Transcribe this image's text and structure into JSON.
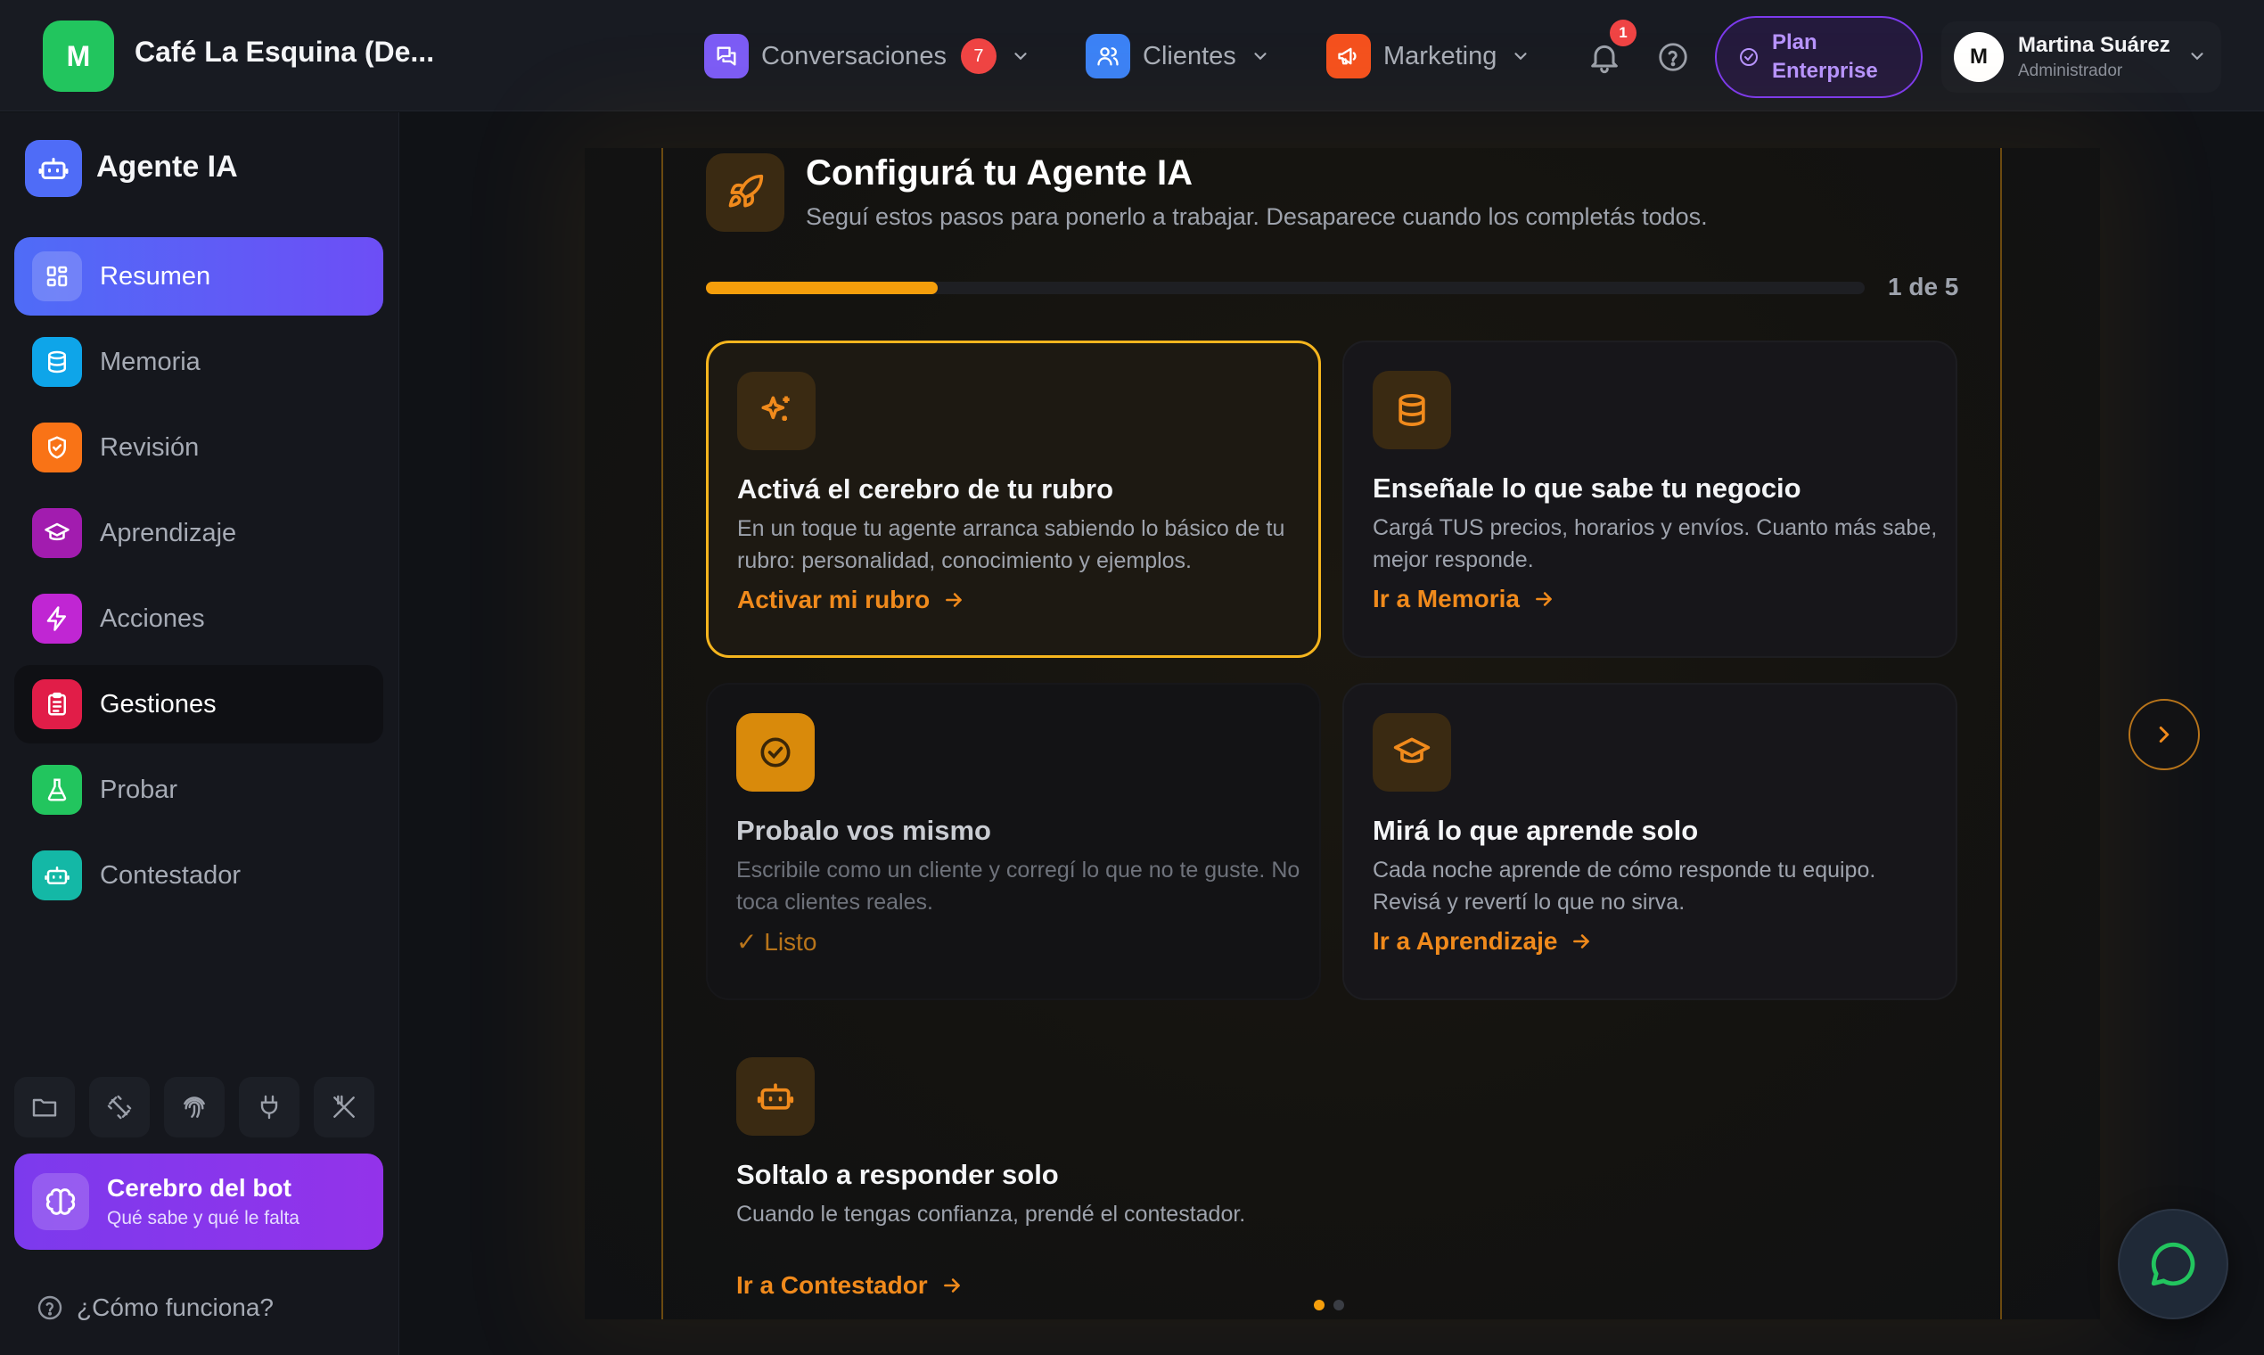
{
  "app": {
    "logo_letter": "M",
    "name": "Café La Esquina (De...",
    "brand_color": "#22c55e"
  },
  "topnav": {
    "items": [
      {
        "label": "Conversaciones",
        "badge": "7",
        "icon": "chat-bubbles-icon",
        "color": "#8b5cf6"
      },
      {
        "label": "Clientes",
        "icon": "users-icon",
        "color": "#3b82f6"
      },
      {
        "label": "Marketing",
        "icon": "megaphone-icon",
        "color": "#f97316"
      }
    ],
    "notifications_badge": "1",
    "plan": {
      "line1": "Plan",
      "line2": "Enterprise"
    },
    "user": {
      "initial": "M",
      "name": "Martina Suárez",
      "role": "Administrador"
    }
  },
  "sidebar": {
    "title": "Agente IA",
    "items": [
      {
        "label": "Resumen",
        "icon": "grid-icon",
        "color": "#6d7cf7",
        "state": "active"
      },
      {
        "label": "Memoria",
        "icon": "database-icon",
        "color": "#0ea5e9"
      },
      {
        "label": "Revisión",
        "icon": "shield-icon",
        "color": "#f97316"
      },
      {
        "label": "Aprendizaje",
        "icon": "graduation-cap-icon",
        "color": "#a21caf"
      },
      {
        "label": "Acciones",
        "icon": "bolt-icon",
        "color": "#c026d3"
      },
      {
        "label": "Gestiones",
        "icon": "clipboard-icon",
        "color": "#e11d48",
        "state": "hover"
      },
      {
        "label": "Probar",
        "icon": "flask-icon",
        "color": "#22c55e"
      },
      {
        "label": "Contestador",
        "icon": "robot-icon",
        "color": "#14b8a6"
      }
    ],
    "tools": [
      "folder-icon",
      "dumbbell-icon",
      "fingerprint-icon",
      "plug-icon",
      "utensils-icon"
    ],
    "brain_card": {
      "title": "Cerebro del bot",
      "subtitle": "Qué sabe y qué le falta"
    },
    "how_link": "¿Cómo funciona?"
  },
  "setup": {
    "title": "Configurá tu Agente IA",
    "subtitle": "Seguí estos pasos para ponerlo a trabajar. Desaparece cuando los completás todos.",
    "progress_fraction": 0.2,
    "progress_label": "1 de 5",
    "steps": [
      {
        "title": "Activá el cerebro de tu rubro",
        "desc": "En un toque tu agente arranca sabiendo lo básico de tu rubro: personalidad, conocimiento y ejemplos.",
        "link": "Activar mi rubro",
        "icon": "sparkles-icon"
      },
      {
        "title": "Enseñale lo que sabe tu negocio",
        "desc": "Cargá TUS precios, horarios y envíos. Cuanto más sabe, mejor responde.",
        "link": "Ir a Memoria",
        "icon": "database-icon"
      },
      {
        "title": "Probalo vos mismo",
        "desc": "Escribile como un cliente y corregí lo que no te guste. No toca clientes reales.",
        "done_label": "✓ Listo",
        "icon": "check-circle-icon"
      },
      {
        "title": "Mirá lo que aprende solo",
        "desc": "Cada noche aprende de cómo responde tu equipo. Revisá y revertí lo que no sirva.",
        "link": "Ir a Aprendizaje",
        "icon": "graduation-cap-icon"
      },
      {
        "title": "Soltalo a responder solo",
        "desc": "Cuando le tengas confianza, prendé el contestador.",
        "link": "Ir a Contestador",
        "icon": "robot-icon"
      }
    ],
    "accent": "#f59e0b"
  }
}
